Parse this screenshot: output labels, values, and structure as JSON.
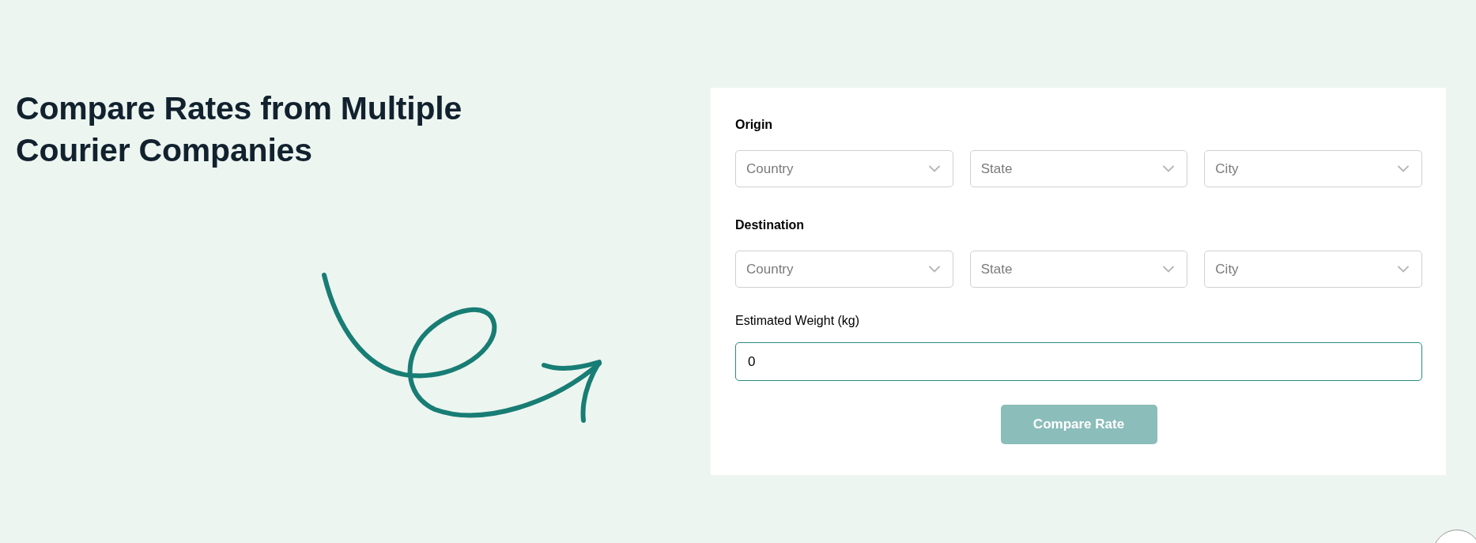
{
  "heading": "Compare Rates from Multiple Courier Companies",
  "sections": [
    {
      "label": "Origin",
      "selects": [
        {
          "placeholder": "Country"
        },
        {
          "placeholder": "State"
        },
        {
          "placeholder": "City"
        }
      ]
    },
    {
      "label": "Destination",
      "selects": [
        {
          "placeholder": "Country"
        },
        {
          "placeholder": "State"
        },
        {
          "placeholder": "City"
        }
      ]
    }
  ],
  "weight": {
    "label": "Estimated Weight (kg)",
    "value": "0"
  },
  "submit": {
    "label": "Compare Rate",
    "disabled": true
  }
}
